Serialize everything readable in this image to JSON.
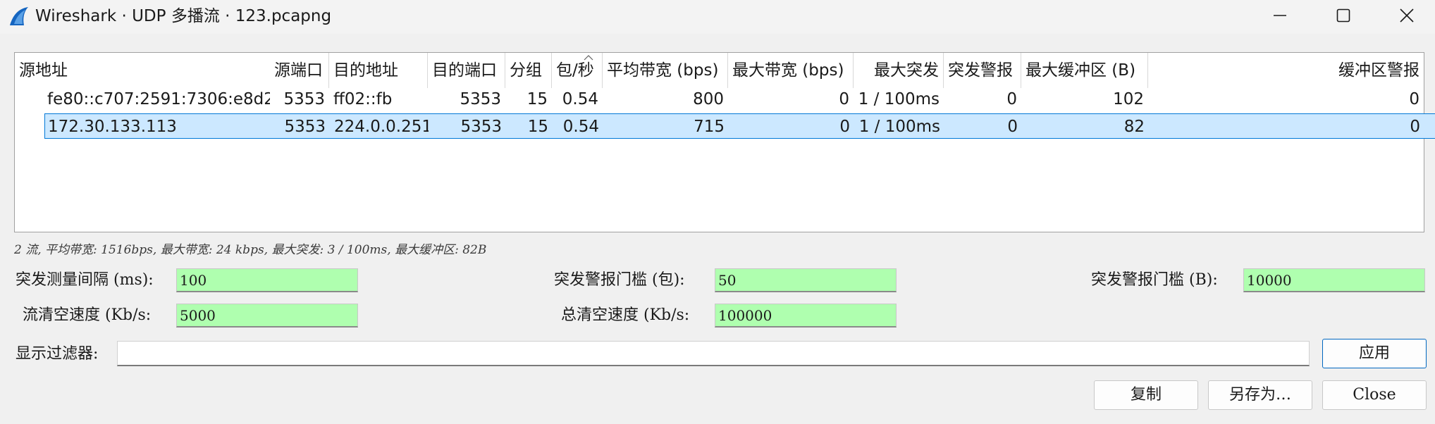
{
  "window": {
    "title": "Wireshark · UDP 多播流 · 123.pcapng"
  },
  "table": {
    "headers": [
      "源地址",
      "源端口",
      "目的地址",
      "目的端口",
      "分组",
      "包/秒",
      "平均带宽 (bps)",
      "最大带宽 (bps)",
      "最大突发",
      "突发警报",
      "最大缓冲区 (B)",
      "缓冲区警报"
    ],
    "rows": [
      [
        "fe80::c707:2591:7306:e8d2",
        "5353",
        "ff02::fb",
        "5353",
        "15",
        "0.54",
        "800",
        "0",
        "1 / 100ms",
        "0",
        "102",
        "0"
      ],
      [
        "172.30.133.113",
        "5353",
        "224.0.0.251",
        "5353",
        "15",
        "0.54",
        "715",
        "0",
        "1 / 100ms",
        "0",
        "82",
        "0"
      ]
    ],
    "selected_row": 1,
    "sorted_column": "包/秒"
  },
  "summary": "2 流, 平均带宽: 1516bps, 最大带宽: 24 kbps, 最大突发: 3 / 100ms, 最大缓冲区: 82B",
  "params": {
    "burst_interval_label": "突发测量间隔 (ms):",
    "burst_interval_value": "100",
    "burst_alarm_pkt_label": "突发警报门槛 (包):",
    "burst_alarm_pkt_value": "50",
    "burst_alarm_bytes_label": "突发警报门槛 (B):",
    "burst_alarm_bytes_value": "10000",
    "stream_drain_label": "流清空速度 (Kb/s:",
    "stream_drain_value": "5000",
    "total_drain_label": "总清空速度 (Kb/s:",
    "total_drain_value": "100000"
  },
  "filter": {
    "label": "显示过滤器:",
    "value": "",
    "apply_label": "应用"
  },
  "buttons": {
    "copy": "复制",
    "save_as": "另存为…",
    "close": "Close"
  },
  "colors": {
    "input_green": "#afffaf",
    "selection": "#cce8ff",
    "selection_border": "#0078d7",
    "fin_blue": "#1565c0"
  }
}
